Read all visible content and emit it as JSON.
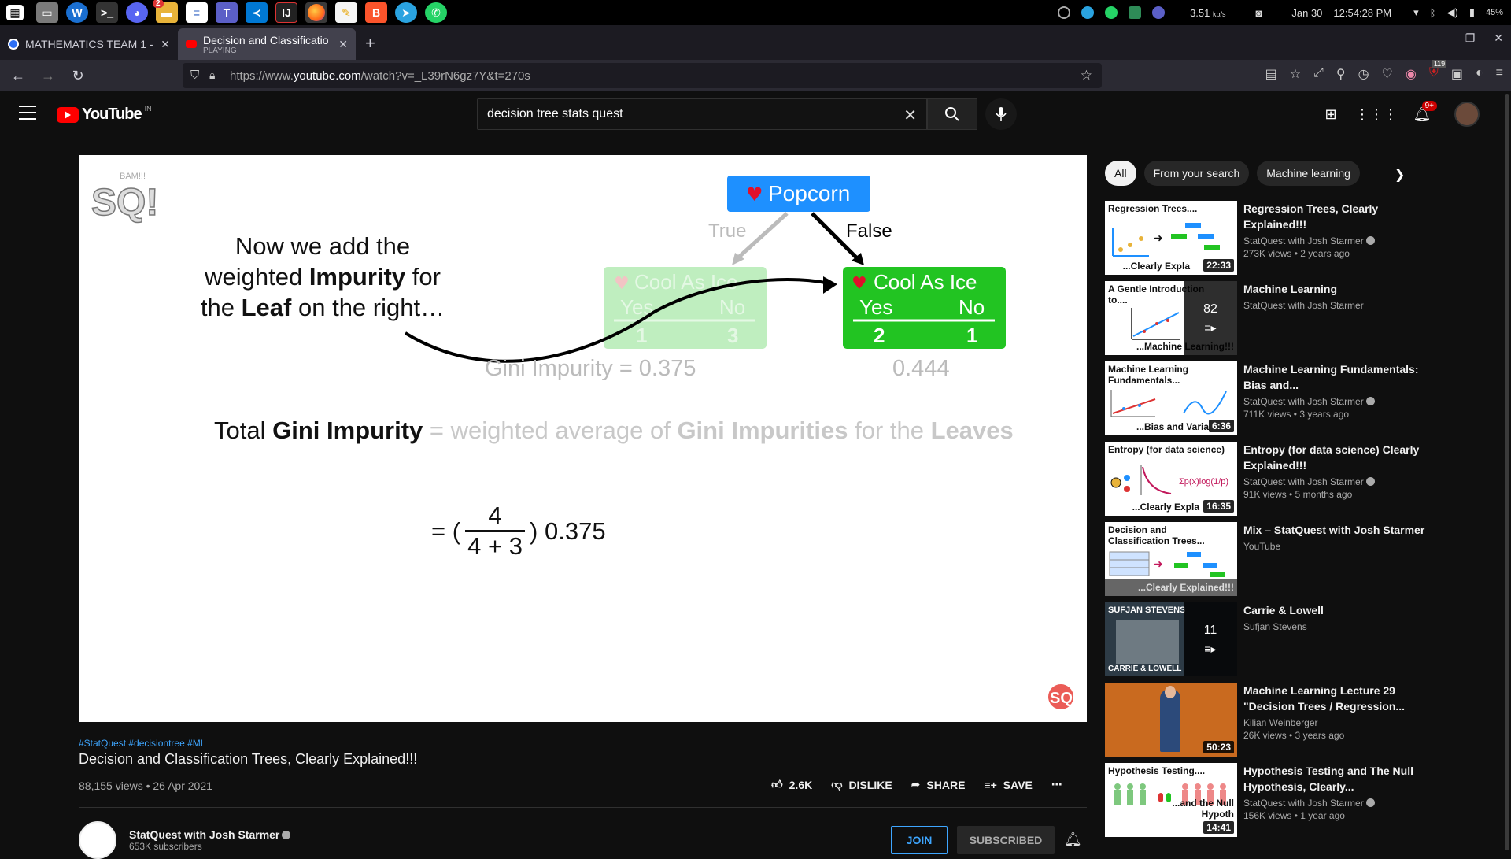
{
  "os": {
    "tray": {
      "net_speed": "3.51",
      "net_unit": "kb/s",
      "date": "Jan 30",
      "time": "12:54:28 PM",
      "battery": "45%"
    },
    "app_badge": "2"
  },
  "browser": {
    "tabs": [
      {
        "title": "MATHEMATICS TEAM 1 -",
        "subtitle": ""
      },
      {
        "title": "Decision and Classificatio",
        "subtitle": "PLAYING"
      }
    ],
    "url_prefix": "https://www.",
    "url_domain": "youtube.com",
    "url_path": "/watch?v=_L39rN6gz7Y&t=270s",
    "ext_badge": "119"
  },
  "youtube": {
    "logo": "YouTube",
    "country": "IN",
    "search_value": "decision tree stats quest",
    "notif_badge": "9+"
  },
  "slide": {
    "caption_line1": "Now we add the",
    "caption_line2_a": "weighted ",
    "caption_line2_b": "Impurity",
    "caption_line2_c": " for",
    "caption_line3_a": "the ",
    "caption_line3_b": "Leaf",
    "caption_line3_c": " on the right…",
    "root_label": "Popcorn",
    "true_label": "True",
    "false_label": "False",
    "leaf_label": "Cool As Ice",
    "yes": "Yes",
    "no": "No",
    "left_yes": "1",
    "left_no": "3",
    "right_yes": "2",
    "right_no": "1",
    "left_gini": "Gini Impurity = 0.375",
    "right_gini": "0.444",
    "total_a": "Total ",
    "total_b": "Gini Impurity",
    "total_c": " = weighted average of ",
    "total_d": "Gini Impurities",
    "total_e": " for the ",
    "total_f": "Leaves",
    "eq_prefix": "= (",
    "eq_num": "4",
    "eq_den": "4 + 3",
    "eq_suffix": ") 0.375",
    "logo_text": "SQ!",
    "logo_small": "BAM!!!"
  },
  "video": {
    "hashtags": "#StatQuest #decisiontree #ML",
    "title": "Decision and Classification Trees, Clearly Explained!!!",
    "meta": "88,155 views • 26 Apr 2021",
    "likes": "2.6K",
    "dislike": "DISLIKE",
    "share": "SHARE",
    "save": "SAVE",
    "channel": "StatQuest with Josh Starmer",
    "subscribers": "653K subscribers",
    "join": "JOIN",
    "subscribed": "SUBSCRIBED"
  },
  "sidebar": {
    "chips": [
      "All",
      "From your search",
      "Machine learning"
    ],
    "items": [
      {
        "title": "Regression Trees, Clearly Explained!!!",
        "channel": "StatQuest with Josh Starmer",
        "views": "273K views • 2 years ago",
        "duration": "22:33",
        "thumb_top": "Regression Trees....",
        "thumb_bottom": "...Clearly Expla",
        "count": "",
        "verified": true
      },
      {
        "title": "Machine Learning",
        "channel": "StatQuest with Josh Starmer",
        "views": "",
        "duration": "",
        "thumb_top": "A Gentle Introduction to....",
        "thumb_bottom": "...Machine Learning!!!",
        "count": "82",
        "verified": false
      },
      {
        "title": "Machine Learning Fundamentals: Bias and...",
        "channel": "StatQuest with Josh Starmer",
        "views": "711K views • 3 years ago",
        "duration": "6:36",
        "thumb_top": "Machine Learning Fundamentals...",
        "thumb_bottom": "...Bias and Varia",
        "count": "",
        "verified": true
      },
      {
        "title": "Entropy (for data science) Clearly Explained!!!",
        "channel": "StatQuest with Josh Starmer",
        "views": "91K views • 5 months ago",
        "duration": "16:35",
        "thumb_top": "Entropy (for data science)",
        "thumb_bottom": "...Clearly Expla",
        "count": "",
        "verified": true
      },
      {
        "title": "Mix – StatQuest with Josh Starmer",
        "channel": "YouTube",
        "views": "",
        "duration": "",
        "thumb_top": "Decision and Classification Trees...",
        "thumb_bottom": "...Clearly Explained!!!",
        "count": "",
        "verified": false
      },
      {
        "title": "Carrie & Lowell",
        "channel": "Sufjan Stevens",
        "views": "",
        "duration": "",
        "thumb_top": "SUFJAN STEVENS",
        "thumb_bottom": "CARRIE & LOWELL",
        "count": "11",
        "verified": false
      },
      {
        "title": "Machine Learning Lecture 29 \"Decision Trees / Regression...",
        "channel": "Kilian Weinberger",
        "views": "26K views • 3 years ago",
        "duration": "50:23",
        "thumb_top": "",
        "thumb_bottom": "",
        "count": "",
        "verified": false
      },
      {
        "title": "Hypothesis Testing and The Null Hypothesis, Clearly...",
        "channel": "StatQuest with Josh Starmer",
        "views": "156K views • 1 year ago",
        "duration": "14:41",
        "thumb_top": "Hypothesis Testing....",
        "thumb_bottom": "...and the Null Hypoth",
        "count": "",
        "verified": true
      }
    ]
  }
}
